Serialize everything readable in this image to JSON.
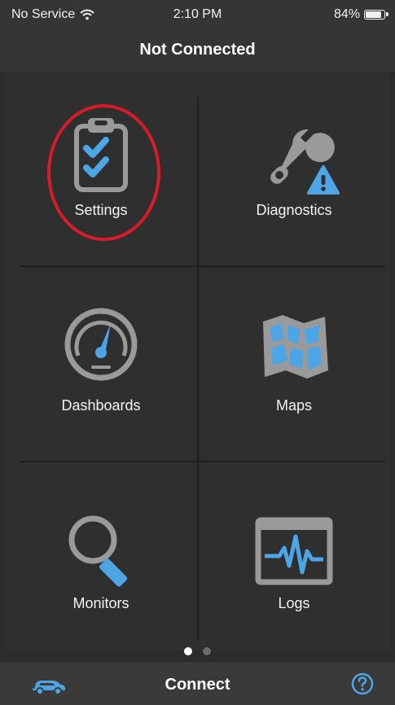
{
  "status_bar": {
    "carrier": "No Service",
    "time": "2:10 PM",
    "battery_percent": "84%",
    "battery_level": 0.84
  },
  "navbar": {
    "title": "Not Connected"
  },
  "tiles": {
    "settings": {
      "label": "Settings",
      "icon": "clipboard-checklist-icon"
    },
    "diagnostics": {
      "label": "Diagnostics",
      "icon": "wrench-warning-icon"
    },
    "dashboards": {
      "label": "Dashboards",
      "icon": "gauge-icon"
    },
    "maps": {
      "label": "Maps",
      "icon": "map-icon"
    },
    "monitors": {
      "label": "Monitors",
      "icon": "magnifier-icon"
    },
    "logs": {
      "label": "Logs",
      "icon": "waveform-log-icon"
    }
  },
  "pager": {
    "pages": 2,
    "current": 1
  },
  "bottom_bar": {
    "connect_label": "Connect",
    "car_icon": "car-icon",
    "help_icon": "help-icon"
  },
  "colors": {
    "accent": "#4ea5e6",
    "highlight": "#d41c2a",
    "icon_grey": "#9a9a9a"
  }
}
